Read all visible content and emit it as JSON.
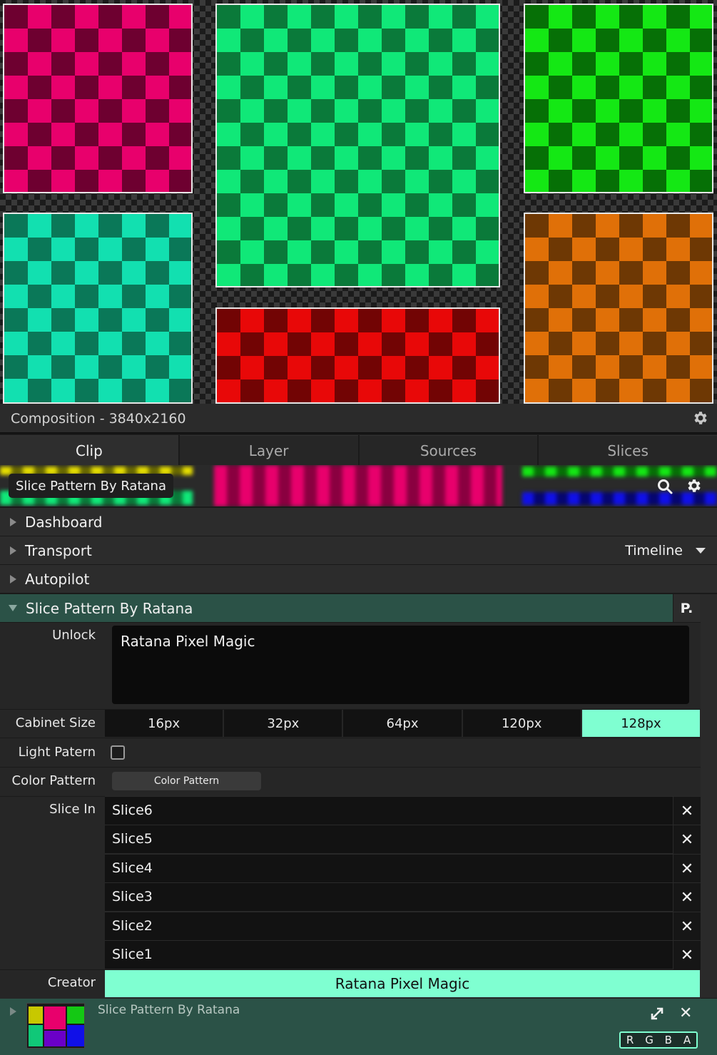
{
  "preview": {
    "slices": [
      {
        "name": "pink",
        "light": "#e8006c",
        "dark": "#6e0030"
      },
      {
        "name": "green-large",
        "light": "#10e878",
        "dark": "#0a7a3a"
      },
      {
        "name": "lime",
        "light": "#14e814",
        "dark": "#067006"
      },
      {
        "name": "teal",
        "light": "#12e0b0",
        "dark": "#0a7858"
      },
      {
        "name": "red",
        "light": "#e80808",
        "dark": "#720404"
      },
      {
        "name": "orange",
        "light": "#e07008",
        "dark": "#6e3804"
      }
    ]
  },
  "composition": {
    "title": "Composition - 3840x2160"
  },
  "tabs": [
    "Clip",
    "Layer",
    "Sources",
    "Slices"
  ],
  "clip": {
    "name": "Slice Pattern By Ratana"
  },
  "sections": {
    "dashboard": "Dashboard",
    "transport": "Transport",
    "transport_mode": "Timeline",
    "autopilot": "Autopilot",
    "effect": "Slice Pattern By Ratana",
    "effect_p": "P."
  },
  "params": {
    "unlock_label": "Unlock",
    "unlock_value": "Ratana Pixel Magic",
    "cabinet_label": "Cabinet Size",
    "cabinet_options": [
      "16px",
      "32px",
      "64px",
      "120px",
      "128px"
    ],
    "cabinet_selected": "128px",
    "light_label": "Light Patern",
    "light_checked": false,
    "color_label": "Color Pattern",
    "color_button": "Color Pattern",
    "slice_in_label": "Slice In",
    "slice_in": [
      "Slice6",
      "Slice5",
      "Slice4",
      "Slice3",
      "Slice2",
      "Slice1"
    ],
    "creator_label": "Creator",
    "creator_value": "Ratana Pixel Magic"
  },
  "bottom": {
    "clip_name": "Slice Pattern By Ratana",
    "channels": [
      "R",
      "G",
      "B",
      "A"
    ]
  },
  "colors": {
    "accent": "#7fffd1",
    "effect_header": "#2b5247"
  }
}
